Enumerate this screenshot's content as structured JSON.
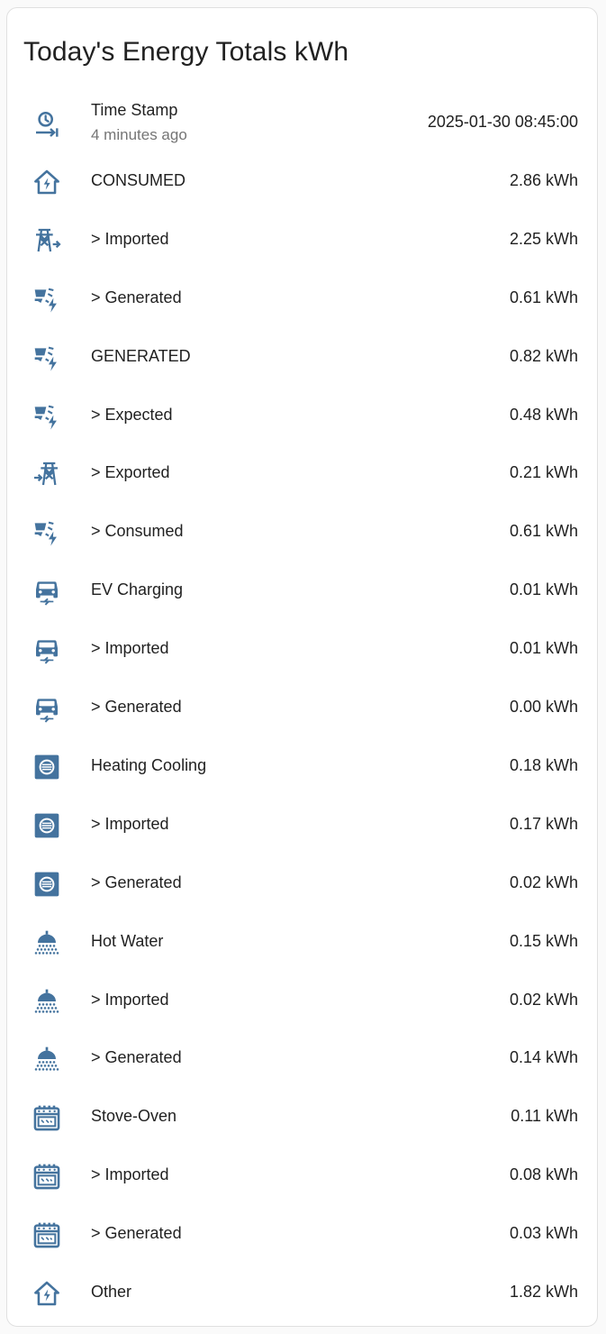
{
  "card": {
    "title": "Today's Energy Totals kWh"
  },
  "colors": {
    "icon": "#44739e",
    "secondary_text": "#757575"
  },
  "rows": [
    {
      "label": "Time Stamp",
      "secondary": "4 minutes ago",
      "value": "2025-01-30 08:45:00",
      "icon": "clock-arrow-icon"
    },
    {
      "label": "CONSUMED",
      "value": "2.86 kWh",
      "icon": "home-lightning-icon"
    },
    {
      "label": "> Imported",
      "value": "2.25 kWh",
      "icon": "transmission-tower-import-icon"
    },
    {
      "label": "> Generated",
      "value": "0.61 kWh",
      "icon": "solar-power-icon"
    },
    {
      "label": "GENERATED",
      "value": "0.82 kWh",
      "icon": "solar-power-icon"
    },
    {
      "label": "> Expected",
      "value": "0.48 kWh",
      "icon": "solar-power-icon"
    },
    {
      "label": "> Exported",
      "value": "0.21 kWh",
      "icon": "transmission-tower-export-icon"
    },
    {
      "label": "> Consumed",
      "value": "0.61 kWh",
      "icon": "solar-power-icon"
    },
    {
      "label": "EV Charging",
      "value": "0.01 kWh",
      "icon": "car-electric-icon"
    },
    {
      "label": "> Imported",
      "value": "0.01 kWh",
      "icon": "car-electric-icon"
    },
    {
      "label": "> Generated",
      "value": "0.00 kWh",
      "icon": "car-electric-icon"
    },
    {
      "label": "Heating Cooling",
      "value": "0.18 kWh",
      "icon": "hvac-icon"
    },
    {
      "label": "> Imported",
      "value": "0.17 kWh",
      "icon": "hvac-icon"
    },
    {
      "label": "> Generated",
      "value": "0.02 kWh",
      "icon": "hvac-icon"
    },
    {
      "label": "Hot Water",
      "value": "0.15 kWh",
      "icon": "shower-head-icon"
    },
    {
      "label": "> Imported",
      "value": "0.02 kWh",
      "icon": "shower-head-icon"
    },
    {
      "label": "> Generated",
      "value": "0.14 kWh",
      "icon": "shower-head-icon"
    },
    {
      "label": "Stove-Oven",
      "value": "0.11 kWh",
      "icon": "stove-icon"
    },
    {
      "label": "> Imported",
      "value": "0.08 kWh",
      "icon": "stove-icon"
    },
    {
      "label": "> Generated",
      "value": "0.03 kWh",
      "icon": "stove-icon"
    },
    {
      "label": "Other",
      "value": "1.82 kWh",
      "icon": "home-lightning-icon"
    }
  ]
}
